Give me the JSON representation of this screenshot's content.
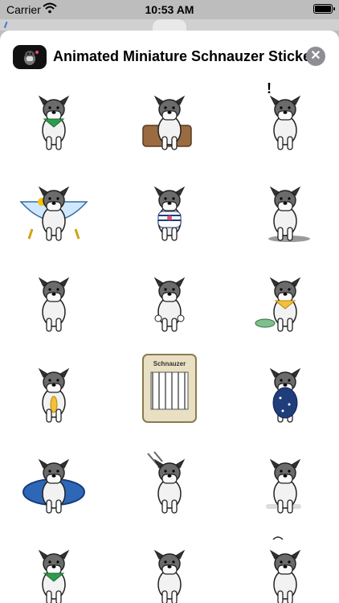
{
  "status_bar": {
    "carrier": "Carrier",
    "time": "10:53 AM",
    "icons": [
      "wifi-icon",
      "battery-icon"
    ]
  },
  "sheet": {
    "title": "Animated Miniature Schnauzer Stickers",
    "close_label": "✕",
    "app_icon": "schnauzer-app-icon"
  },
  "stickers": [
    {
      "name": "sticker-sitting-green-bandana",
      "crate_label": ""
    },
    {
      "name": "sticker-on-suitcase",
      "crate_label": ""
    },
    {
      "name": "sticker-exclaim",
      "crate_label": ""
    },
    {
      "name": "sticker-bathtub-duck",
      "crate_label": ""
    },
    {
      "name": "sticker-striped-shirt",
      "crate_label": ""
    },
    {
      "name": "sticker-running",
      "crate_label": ""
    },
    {
      "name": "sticker-sitting-front",
      "crate_label": ""
    },
    {
      "name": "sticker-thumbs-up",
      "crate_label": ""
    },
    {
      "name": "sticker-food-bowl",
      "crate_label": ""
    },
    {
      "name": "sticker-holding-fish",
      "crate_label": ""
    },
    {
      "name": "sticker-pet-carrier",
      "crate_label": "Schnauzer"
    },
    {
      "name": "sticker-polka-dot-raincoat",
      "crate_label": ""
    },
    {
      "name": "sticker-sleeping-bed",
      "crate_label": ""
    },
    {
      "name": "sticker-grooming",
      "crate_label": ""
    },
    {
      "name": "sticker-bone",
      "crate_label": ""
    },
    {
      "name": "sticker-lying-bandana",
      "crate_label": ""
    },
    {
      "name": "sticker-playing",
      "crate_label": ""
    },
    {
      "name": "sticker-dizzy",
      "crate_label": ""
    }
  ],
  "colors": {
    "accent_green": "#2e9b4d",
    "suitcase": "#9a6a40",
    "tub": "#cfe8ff",
    "bed": "#2f67b8",
    "raincoat": "#1f3d7a",
    "bandana_yellow": "#f2c13a"
  }
}
